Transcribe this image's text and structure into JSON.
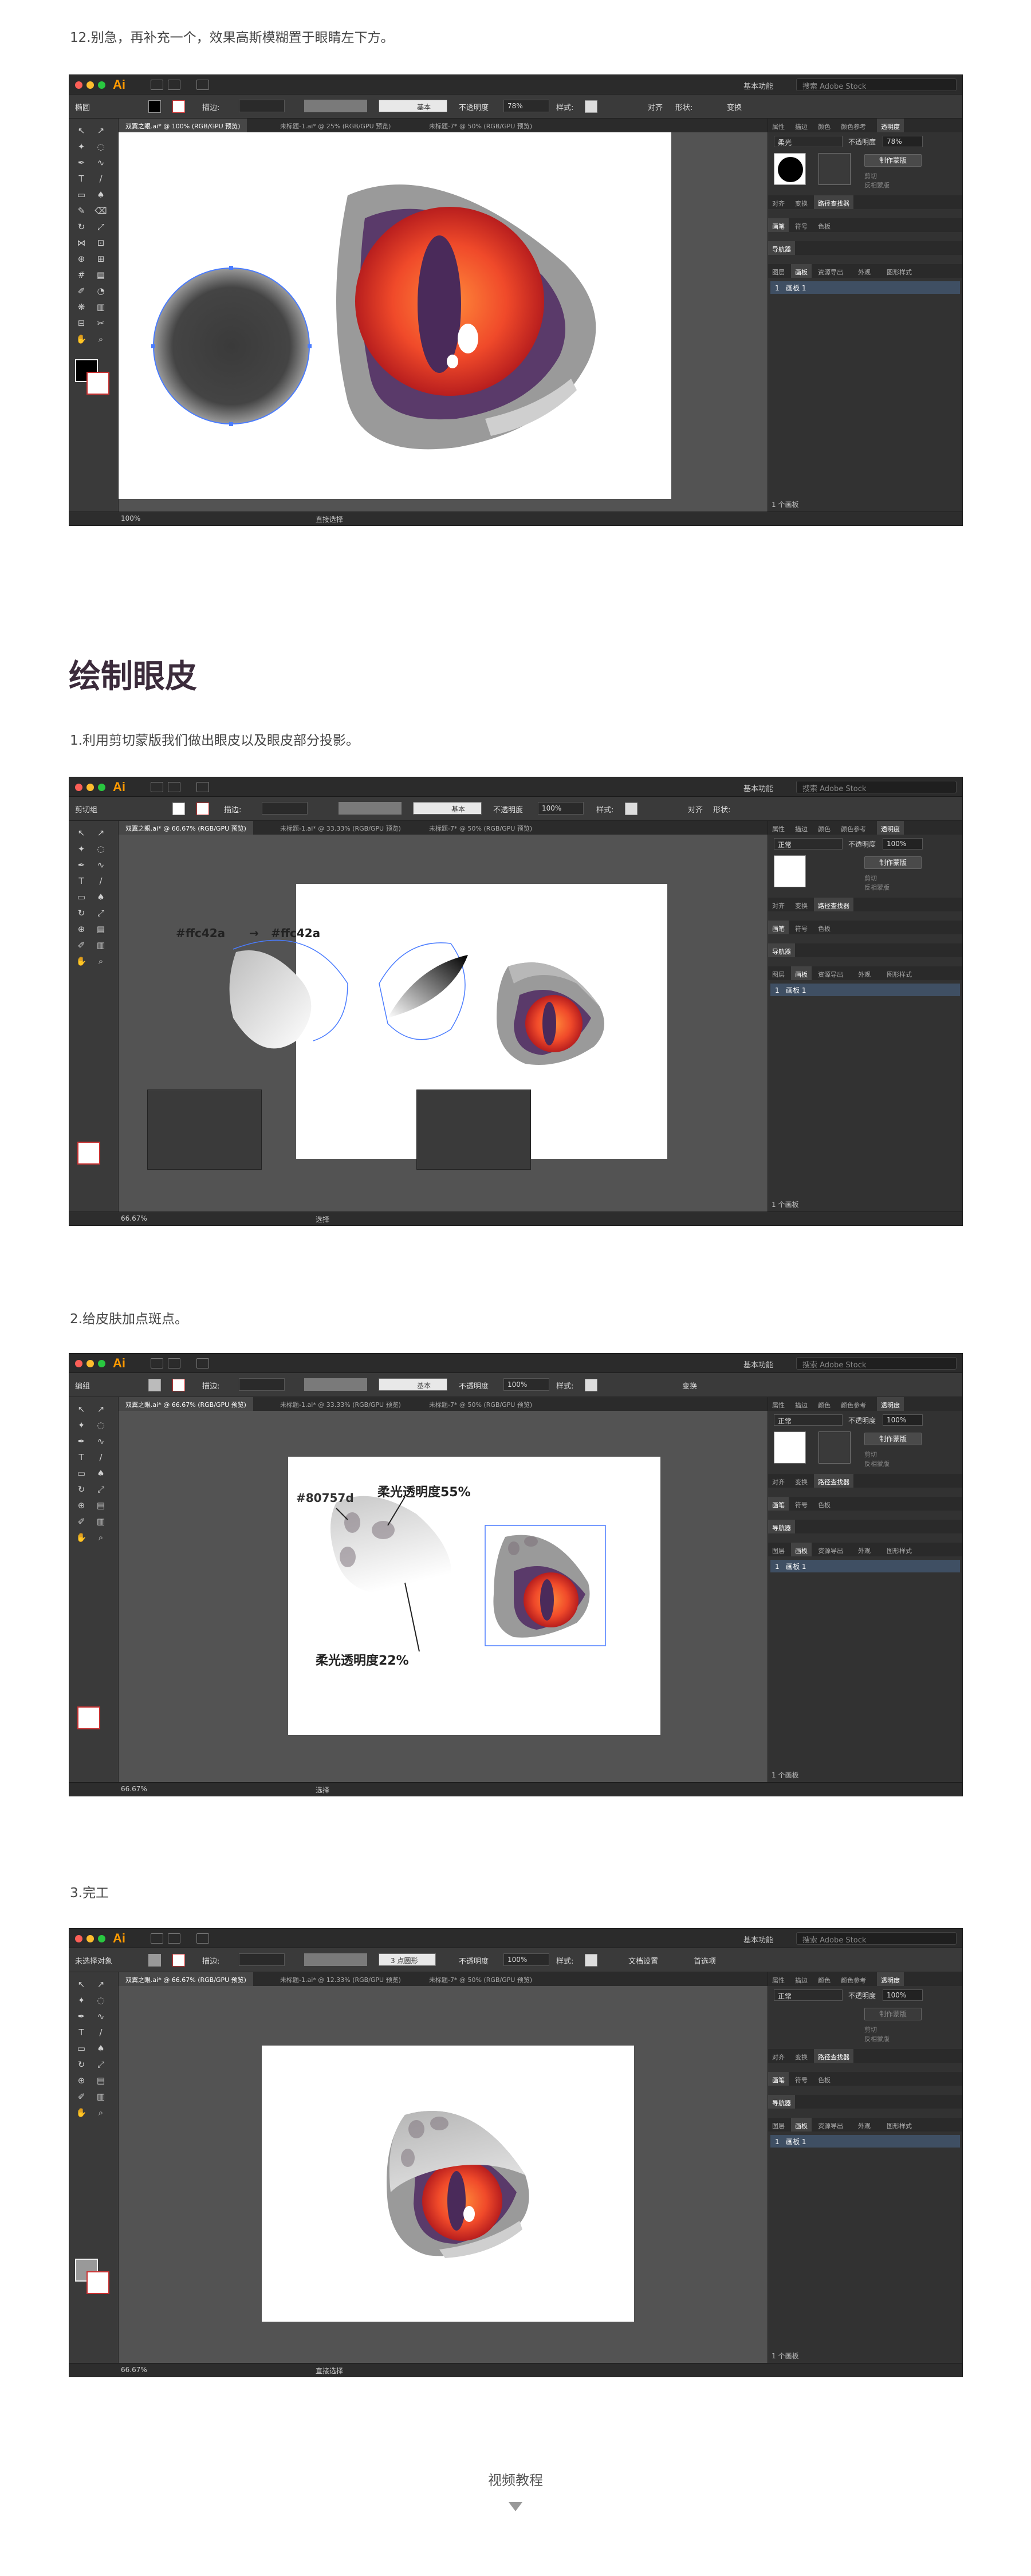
{
  "captions": {
    "step12": "12.别急，再补充一个，效果高斯模糊置于眼睛左下方。",
    "section_title": "绘制眼皮",
    "step1": "1.利用剪切蒙版我们做出眼皮以及眼皮部分投影。",
    "step2": "2.给皮肤加点斑点。",
    "step3": "3.完工",
    "video": "视频教程"
  },
  "app": {
    "logo": "Ai",
    "workspace": "基本功能",
    "stock_placeholder": "搜索 Adobe Stock",
    "layers_count": "1 个画板",
    "layer_name": "画板 1",
    "layer_index": "1",
    "mask_button": "制作蒙版",
    "clip": "剪切",
    "invert": "反相蒙版",
    "opacity_label": "不透明度",
    "stroke_label": "描边:",
    "style_label": "样式:",
    "basic": "基本",
    "align": "对齐",
    "shape": "形状:",
    "transform": "变换",
    "doc_setup": "文档设置",
    "prefs": "首选项",
    "point_round": "3 点圆形"
  },
  "windows": [
    {
      "mode": "椭圆",
      "tabs": [
        "双翼之眼.ai* @ 100% (RGB/GPU 预览)",
        "未标题-1.ai* @ 25% (RGB/GPU 预览)",
        "未标题-7* @ 50% (RGB/GPU 预览)"
      ],
      "opacity": "78%",
      "blend": "柔光",
      "panel_opacity": "78%",
      "zoom": "100%",
      "status_tool": "直接选择",
      "panel_tabs1": [
        "属性",
        "描边",
        "颜色",
        "颜色参考",
        "透明度"
      ],
      "panel_tabs2": [
        "对齐",
        "变换",
        "路径查找器"
      ],
      "panel_tabs3": [
        "画笔",
        "符号",
        "色板"
      ],
      "panel_tabs4": [
        "导航器"
      ],
      "panel_tabs5": [
        "图层",
        "画板",
        "资源导出",
        "外观",
        "图形样式"
      ]
    },
    {
      "mode": "剪切组",
      "tabs": [
        "双翼之眼.ai* @ 66.67% (RGB/GPU 预览)",
        "未标题-1.ai* @ 33.33% (RGB/GPU 预览)",
        "未标题-7* @ 50% (RGB/GPU 预览)"
      ],
      "opacity": "100%",
      "blend": "正常",
      "panel_opacity": "100%",
      "zoom": "66.67%",
      "status_tool": "选择",
      "annotation_a": "#ffc42a",
      "annotation_arrow": "→",
      "annotation_b": "#ffc42a"
    },
    {
      "mode": "编组",
      "tabs": [
        "双翼之眼.ai* @ 66.67% (RGB/GPU 预览)",
        "未标题-1.ai* @ 33.33% (RGB/GPU 预览)",
        "未标题-7* @ 50% (RGB/GPU 预览)"
      ],
      "opacity": "100%",
      "blend": "正常",
      "panel_opacity": "100%",
      "zoom": "66.67%",
      "status_tool": "选择",
      "annotation_color": "#80757d",
      "annotation_55": "柔光透明度55%",
      "annotation_22": "柔光透明度22%"
    },
    {
      "mode": "未选择对象",
      "tabs": [
        "双翼之眼.ai* @ 66.67% (RGB/GPU 预览)",
        "未标题-1.ai* @ 12.33% (RGB/GPU 预览)",
        "未标题-7* @ 50% (RGB/GPU 预览)"
      ],
      "opacity": "100%",
      "blend": "正常",
      "panel_opacity": "100%",
      "zoom": "66.67%",
      "status_tool": "直接选择"
    }
  ],
  "colors": {
    "ui_dark": "#323232",
    "canvas": "#535353",
    "eye_red": "#e8312a",
    "eye_orange": "#ff8a3a",
    "eyelid_gray": "#9a9a9a",
    "eyelid_purple": "#5a3a6a",
    "selection_blue": "#4a7cff"
  }
}
